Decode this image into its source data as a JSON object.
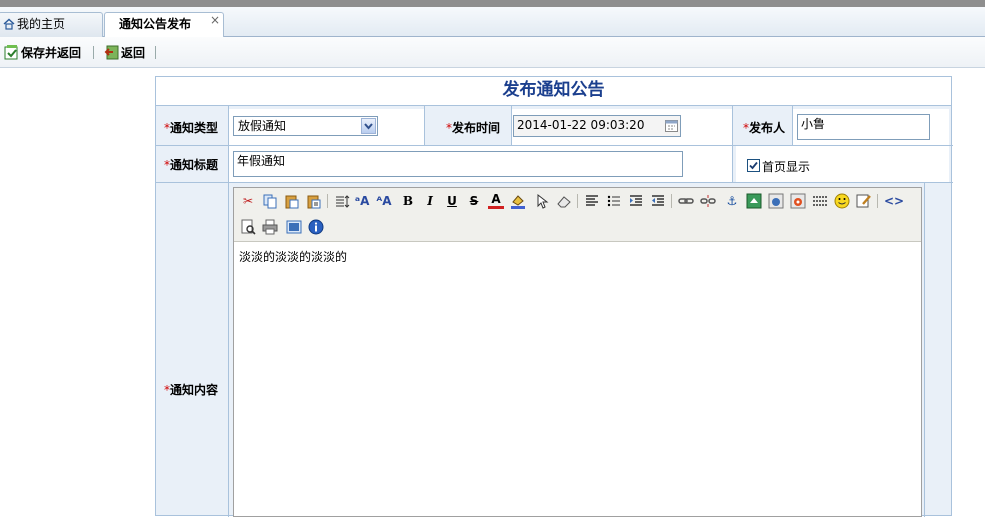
{
  "tabs": [
    {
      "label": "我的主页"
    },
    {
      "label": "通知公告发布",
      "close": "×"
    }
  ],
  "toolbar": {
    "save_return": "保存并返回",
    "back": "返回"
  },
  "form": {
    "title": "发布通知公告",
    "required_mark": "*",
    "type_label": "通知类型",
    "type_value": "放假通知",
    "time_label": "发布时间",
    "time_value": "2014-01-22 09:03:20",
    "publisher_label": "发布人",
    "publisher_value": "小鲁",
    "subject_label": "通知标题",
    "subject_value": "年假通知",
    "homepage_label": "首页显示",
    "homepage_checked": true,
    "content_label": "通知内容",
    "content_value": "淡淡的淡淡的淡淡的"
  },
  "editor_icons": [
    "cut",
    "copy",
    "paste",
    "paste-text",
    "line-height",
    "font-family",
    "font-size",
    "bold",
    "italic",
    "underline",
    "strikethrough",
    "font-color",
    "background-color",
    "select",
    "eraser",
    "align-left",
    "list",
    "indent",
    "outdent",
    "link",
    "unlink",
    "anchor",
    "image",
    "flash",
    "media",
    "hr",
    "emoticon",
    "edit",
    "source",
    "preview",
    "print",
    "fullscreen",
    "about"
  ],
  "colors": {
    "accent": "#1b3f8e",
    "required": "#d00000",
    "border": "#a9c2dc"
  }
}
